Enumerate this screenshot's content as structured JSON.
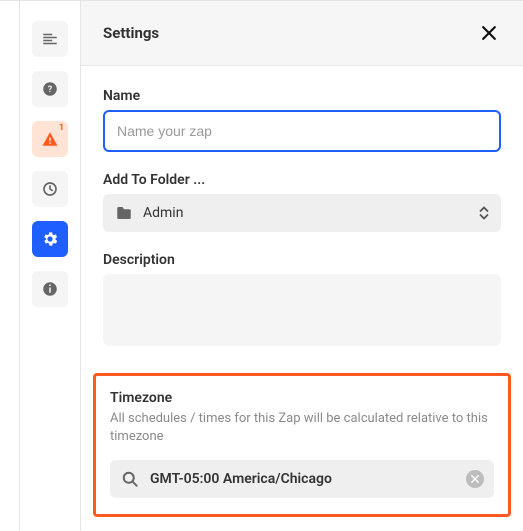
{
  "header": {
    "title": "Settings"
  },
  "rail": {
    "warn_badge": "1"
  },
  "name": {
    "label": "Name",
    "placeholder": "Name your zap",
    "value": ""
  },
  "folder": {
    "label": "Add To Folder ...",
    "selected": "Admin"
  },
  "description": {
    "label": "Description",
    "value": ""
  },
  "timezone": {
    "label": "Timezone",
    "help": "All schedules / times for this Zap will be calculated relative to this timezone",
    "value": "GMT-05:00 America/Chicago"
  }
}
